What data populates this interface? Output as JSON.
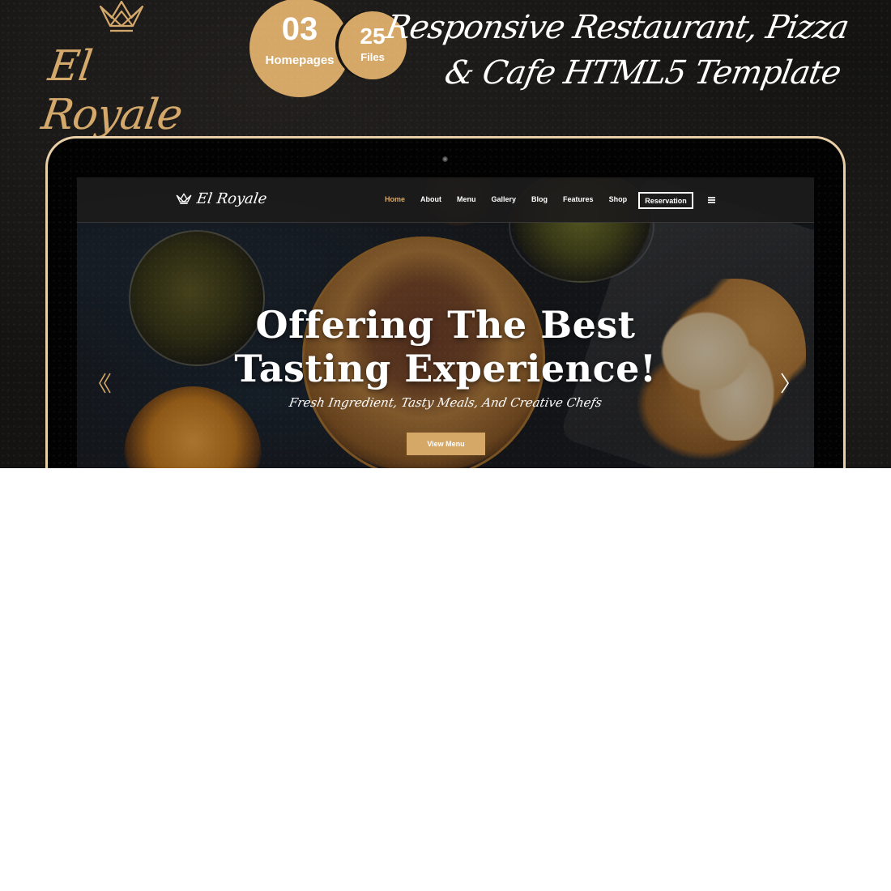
{
  "brand": {
    "name": "El Royale",
    "logo_icon": "crown-icon"
  },
  "badges": {
    "homepages": {
      "value": "03",
      "label": "Homepages"
    },
    "files": {
      "value": "25",
      "label": "Files"
    }
  },
  "tagline": {
    "line1": "Responsive Restaurant, Pizza",
    "line2": "& Cafe HTML5 Template"
  },
  "colors": {
    "accent": "#d6a868",
    "background": "#141312",
    "monitor_bezel": "#e9cfa8"
  },
  "preview": {
    "nav": {
      "logo_text": "El Royale",
      "links": [
        "Home",
        "About",
        "Menu",
        "Gallery",
        "Blog",
        "Features",
        "Shop"
      ],
      "active_link": "Home",
      "cta_label": "Reservation",
      "menu_icon": "hamburger-icon"
    },
    "hero": {
      "title_line1": "Offering The Best",
      "title_line2": "Tasting Experience!",
      "subtitle": "Fresh Ingredient, Tasty Meals, And Creative Chefs",
      "button_label": "View Menu",
      "prev_icon": "double-chevron-left-icon",
      "next_icon": "chevron-right-icon"
    }
  }
}
